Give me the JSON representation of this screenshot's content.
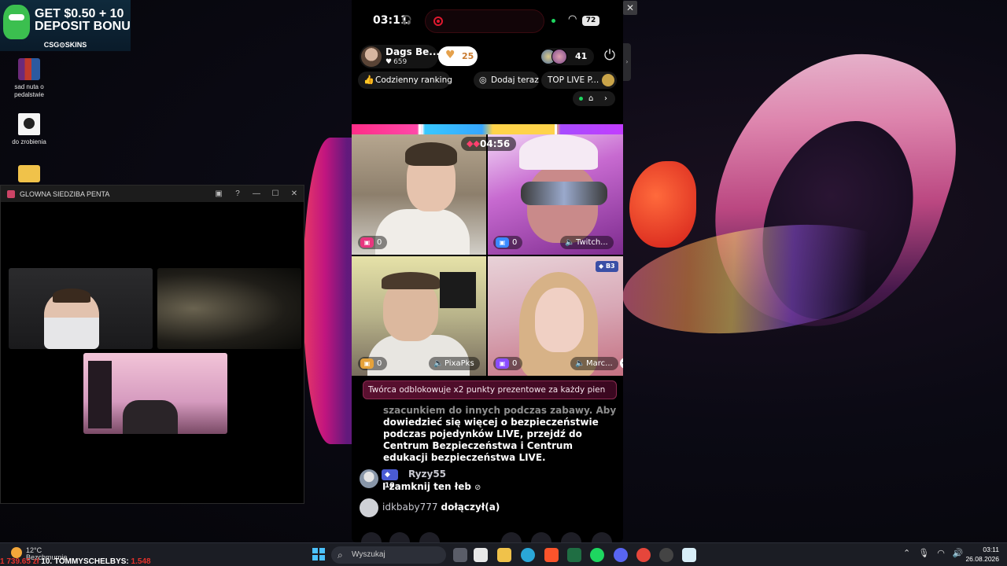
{
  "ad": {
    "line1": "GET $0.50 + 10",
    "line2": "DEPOSIT BONU",
    "brand": "CSG⊙SKINS"
  },
  "desktop_icons": [
    {
      "label": "sad nuta o pedalstwie"
    },
    {
      "label": "do zrobienia"
    }
  ],
  "side_window": {
    "title": "GLOWNA SIEDZIBA PENTA"
  },
  "phone": {
    "status": {
      "time": "03:11",
      "battery": "72"
    },
    "host": {
      "name": "Dags Be...",
      "likes": "659",
      "follow_count": "25"
    },
    "viewer_count": "41",
    "chips": {
      "ranking": "Codzienny ranking",
      "add": "Dodaj teraz",
      "top": "TOP LIVE P..."
    },
    "timer": "04:56",
    "tiles": [
      {
        "gifts": "0",
        "speaker": ""
      },
      {
        "gifts": "0",
        "speaker": "Twitch..."
      },
      {
        "gifts": "0",
        "speaker": "PixaPks"
      },
      {
        "gifts": "0",
        "speaker": "Marc...",
        "rank": "B3"
      }
    ],
    "banner": "Twórca odblokowuje x2 punkty prezentowe za każdy pien",
    "safety_faded": "szacunkiem do innych podczas zabawy. Aby",
    "safety_text": "dowiedzieć się więcej o bezpieczeństwie podczas pojedynków LIVE, przejdź do Centrum Bezpieczeństwa i Centrum edukacji bezpieczeństwa LIVE.",
    "comments": [
      {
        "level": "18",
        "user": "Ryzy55",
        "message": "I zamknij ten łeb"
      },
      {
        "user": "idkbaby777",
        "action": "dołączył(a)"
      }
    ]
  },
  "taskbar": {
    "weather_temp": "12°C",
    "weather_desc": "Bezchmurnie",
    "ticker_prefix": "1 739.65 zł",
    "ticker_name": "10. TOMMYSCHELBYS:",
    "ticker_value": "1.548",
    "search_placeholder": "Wyszukaj",
    "time": "03:11",
    "date": "26.08.2026"
  },
  "colors": {
    "accent_pink": "#ff2d87",
    "accent_blue": "#36a6ff",
    "accent_gold": "#ffd34a",
    "accent_purple": "#a74cff",
    "taskbar": "#1b1d24"
  }
}
